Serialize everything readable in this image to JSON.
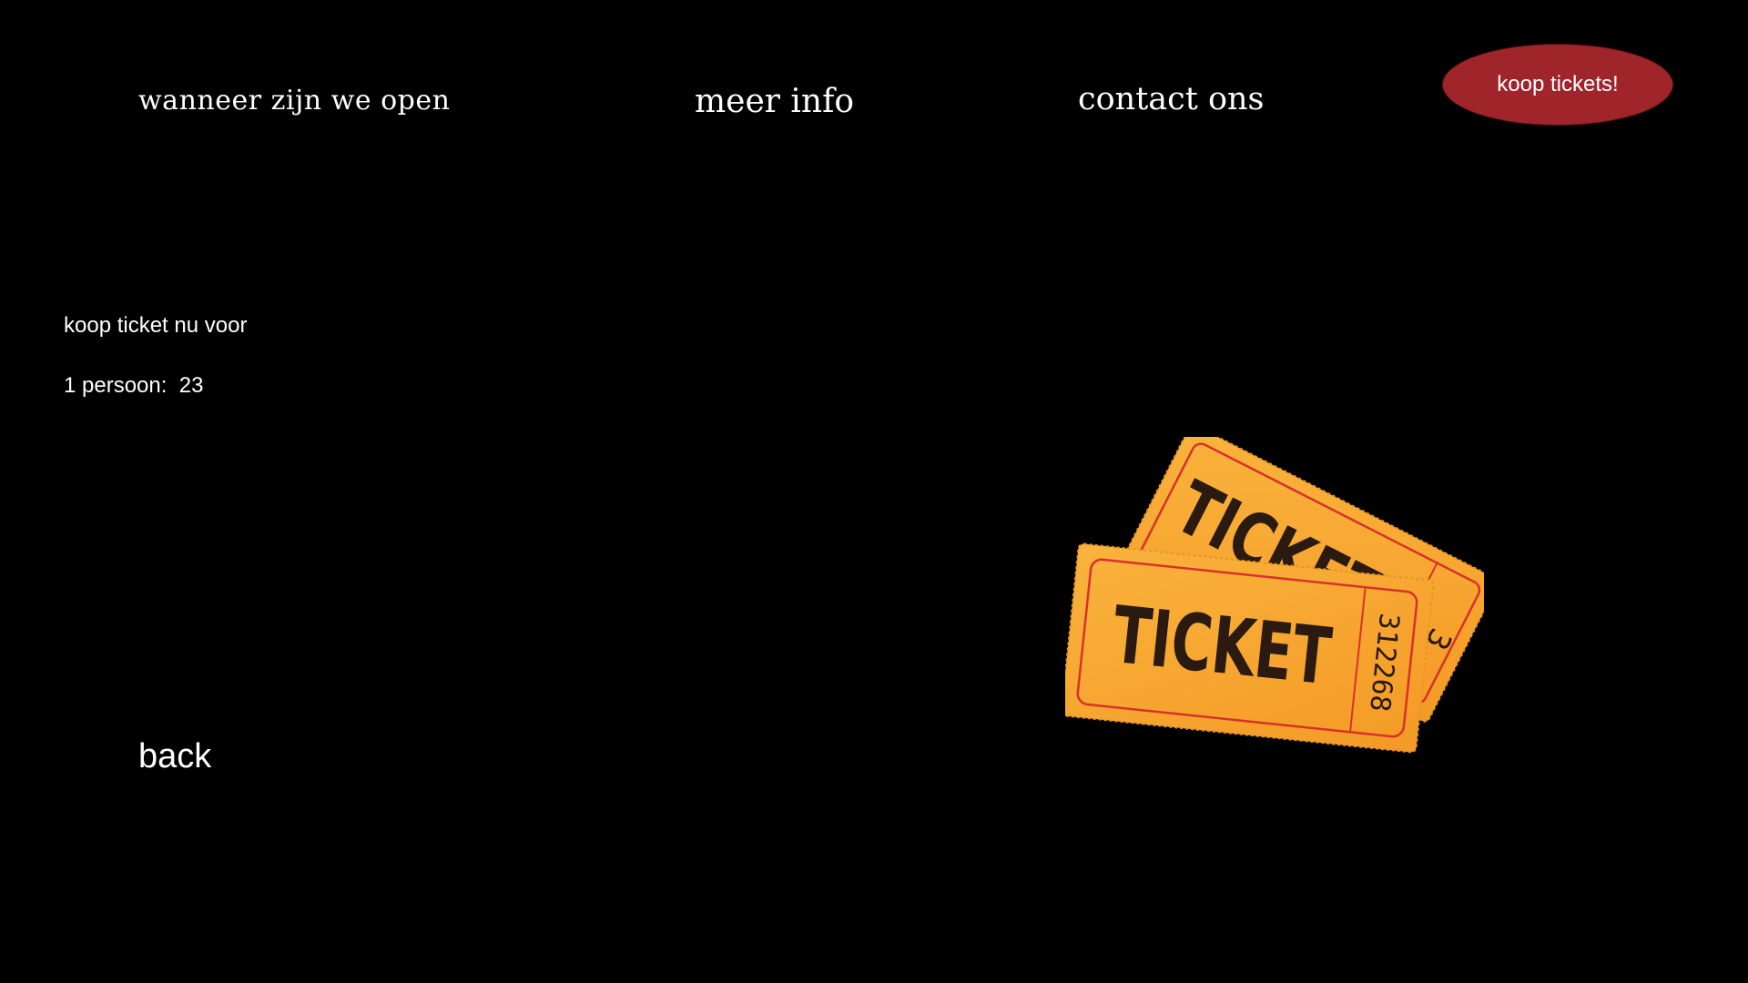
{
  "nav": {
    "opening_label": "wanneer zijn we open",
    "info_label": "meer info",
    "contact_label": "contact ons",
    "buy_button_label": "koop tickets!"
  },
  "main": {
    "intro_text": "koop ticket nu voor",
    "price_line": "1 persoon:  23",
    "back_label": "back"
  },
  "ticket_image": {
    "word": "TICKET",
    "number": "312268",
    "back_number": "3"
  },
  "colors": {
    "background": "#000000",
    "button": "#a0252b",
    "ticket": "#f7a832",
    "ticket_border": "#d8322a",
    "ticket_text": "#2a1a10"
  }
}
